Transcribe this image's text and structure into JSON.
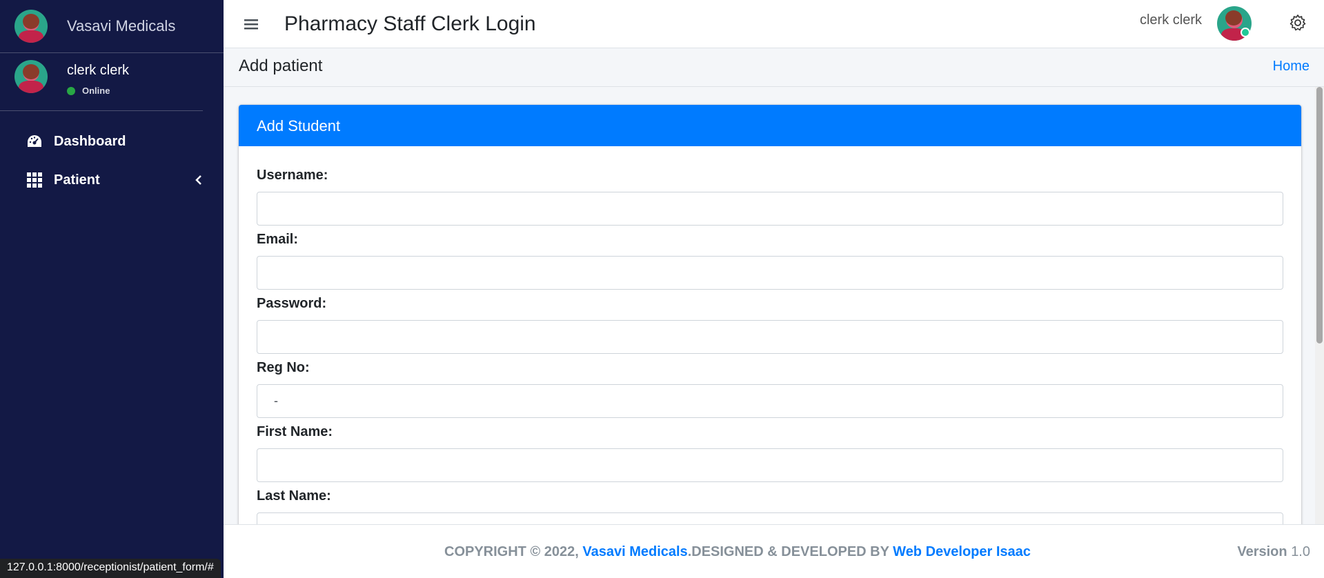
{
  "sidebar": {
    "brand": "Vasavi Medicals",
    "user_name": "clerk clerk",
    "user_status": "Online",
    "items": [
      {
        "label": "Dashboard",
        "icon": "gauge-icon"
      },
      {
        "label": "Patient",
        "icon": "grid-icon"
      }
    ]
  },
  "topbar": {
    "title": "Pharmacy Staff Clerk Login",
    "user_name": "clerk clerk"
  },
  "content_header": {
    "title": "Add patient",
    "breadcrumb": "Home"
  },
  "card": {
    "title": "Add Student",
    "fields": {
      "username": {
        "label": "Username:",
        "value": ""
      },
      "email": {
        "label": "Email:",
        "value": ""
      },
      "password": {
        "label": "Password:",
        "value": ""
      },
      "reg_no": {
        "label": "Reg No:",
        "value": "-"
      },
      "first_name": {
        "label": "First Name:",
        "value": ""
      },
      "last_name": {
        "label": "Last Name:",
        "value": ""
      }
    }
  },
  "footer": {
    "copyright": "COPYRIGHT © 2022, ",
    "brand_link": "Vasavi Medicals",
    "designed": ".DESIGNED & DEVELOPED BY ",
    "dev_link": "Web Developer Isaac",
    "version_label": "Version",
    "version": "1.0"
  },
  "status_url": "127.0.0.1:8000/receptionist/patient_form/#",
  "colors": {
    "sidebar": "#131945",
    "primary": "#007bff",
    "online": "#28a745"
  }
}
